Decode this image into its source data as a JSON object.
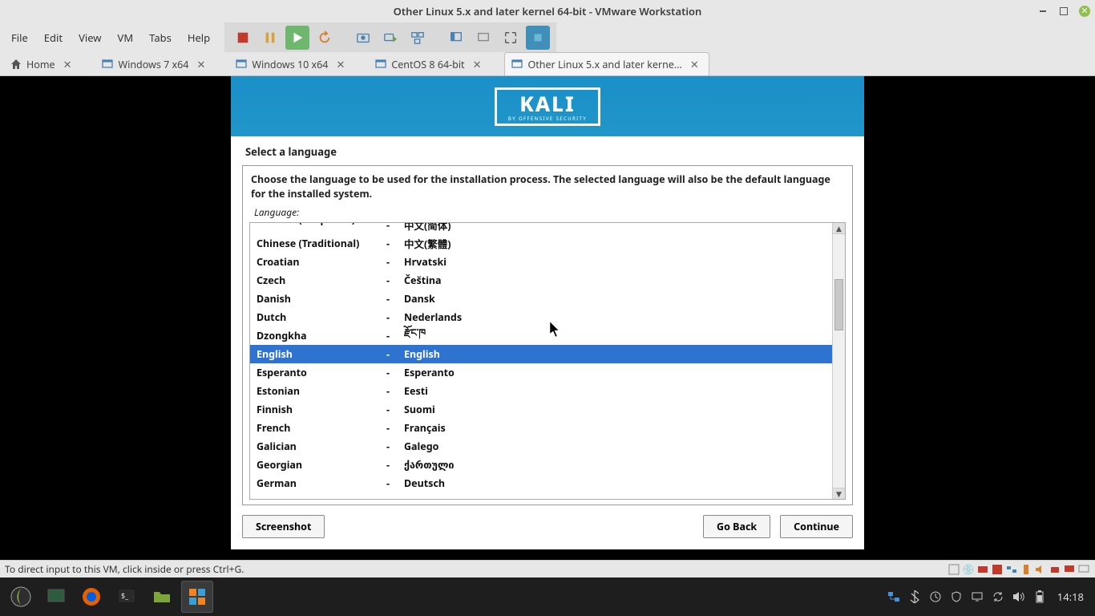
{
  "window": {
    "title": "Other Linux 5.x and later kernel 64-bit - VMware Workstation"
  },
  "menus": [
    "File",
    "Edit",
    "View",
    "VM",
    "Tabs",
    "Help"
  ],
  "tabs": [
    {
      "label": "Home",
      "close": true,
      "icon": "home"
    },
    {
      "label": "Windows 7 x64",
      "close": true,
      "icon": "vm"
    },
    {
      "label": "Windows 10 x64",
      "close": true,
      "icon": "vm"
    },
    {
      "label": "CentOS 8 64-bit",
      "close": true,
      "icon": "vm"
    },
    {
      "label": "Other Linux 5.x and later kerne…",
      "close": true,
      "icon": "vm",
      "active": true
    }
  ],
  "kali": {
    "name": "KALI",
    "sub": "BY OFFENSIVE SECURITY"
  },
  "step_title": "Select a language",
  "instruction": "Choose the language to be used for the installation process. The selected language will also be the default language for the installed system.",
  "lang_label": "Language:",
  "languages": [
    {
      "en": "Chinese (Simplified)",
      "sep": "-",
      "native": "中文(简体)",
      "clip": true
    },
    {
      "en": "Chinese (Traditional)",
      "sep": "-",
      "native": "中文(繁體)"
    },
    {
      "en": "Croatian",
      "sep": "-",
      "native": "Hrvatski"
    },
    {
      "en": "Czech",
      "sep": "-",
      "native": "Čeština"
    },
    {
      "en": "Danish",
      "sep": "-",
      "native": "Dansk"
    },
    {
      "en": "Dutch",
      "sep": "-",
      "native": "Nederlands"
    },
    {
      "en": "Dzongkha",
      "sep": "-",
      "native": "རྫོང་ཁ"
    },
    {
      "en": "English",
      "sep": "-",
      "native": "English",
      "selected": true
    },
    {
      "en": "Esperanto",
      "sep": "-",
      "native": "Esperanto"
    },
    {
      "en": "Estonian",
      "sep": "-",
      "native": "Eesti"
    },
    {
      "en": "Finnish",
      "sep": "-",
      "native": "Suomi"
    },
    {
      "en": "French",
      "sep": "-",
      "native": "Français"
    },
    {
      "en": "Galician",
      "sep": "-",
      "native": "Galego"
    },
    {
      "en": "Georgian",
      "sep": "-",
      "native": "ქართული"
    },
    {
      "en": "German",
      "sep": "-",
      "native": "Deutsch"
    }
  ],
  "buttons": {
    "screenshot": "Screenshot",
    "goback": "Go Back",
    "continue": "Continue"
  },
  "status": "To direct input to this VM, click inside or press Ctrl+G.",
  "clock": "14:18"
}
